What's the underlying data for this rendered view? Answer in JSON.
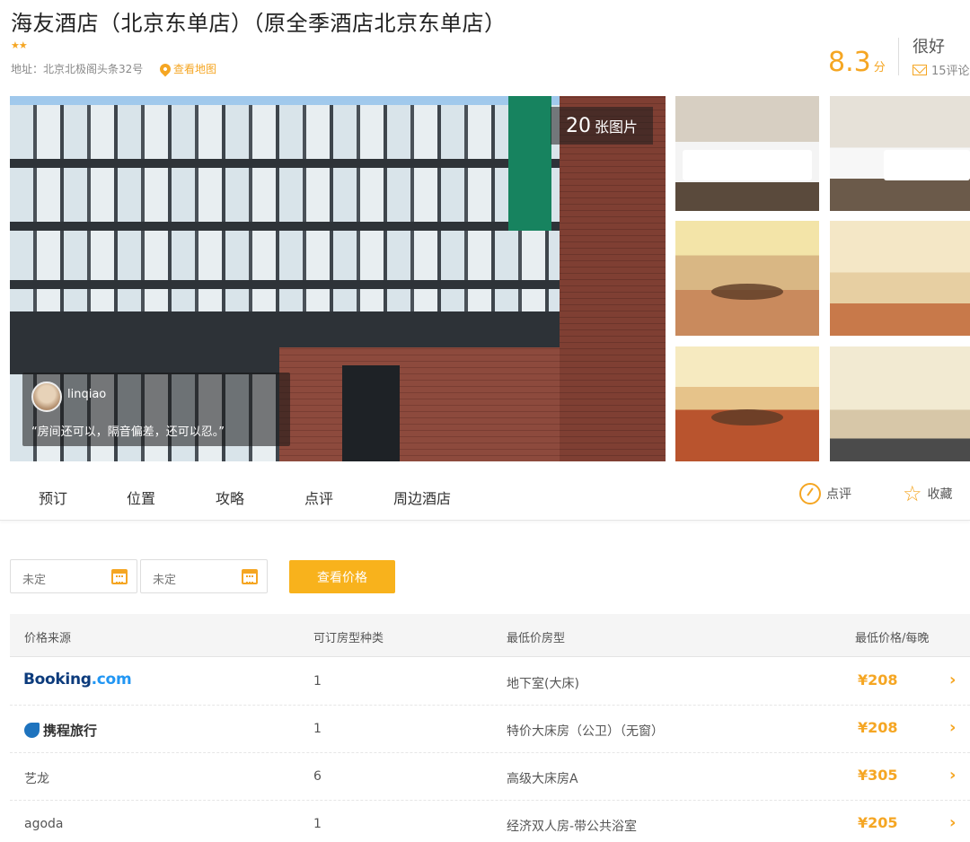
{
  "hotel": {
    "title": "海友酒店（北京东单店）（原全季酒店北京东单店）",
    "stars": "★★",
    "address": "地址：北京北极阁头条32号",
    "map_link": "查看地图"
  },
  "rating": {
    "score": "8.3",
    "score_unit": "分",
    "label": "很好",
    "reviews": "15评论"
  },
  "gallery": {
    "photo_count": "20",
    "photo_count_label": "张图片",
    "review_user": "linqiao",
    "review_quote": "“房间还可以，隔音偏差，还可以忍。”"
  },
  "tabs": [
    "预订",
    "位置",
    "攻略",
    "点评",
    "周边酒店"
  ],
  "actions": {
    "review": "点评",
    "favorite": "收藏"
  },
  "search": {
    "checkin": "未定",
    "checkout": "未定",
    "button": "查看价格"
  },
  "table": {
    "headers": [
      "价格来源",
      "可订房型种类",
      "最低价房型",
      "最低价格/每晚"
    ],
    "rows": [
      {
        "source": "Booking.com",
        "source_a": "Booking",
        "source_b": ".com",
        "count": "1",
        "room": "地下室(大床)",
        "price": "¥208"
      },
      {
        "source": "携程旅行",
        "count": "1",
        "room": "特价大床房（公卫）（无窗）",
        "price": "¥208"
      },
      {
        "source": "艺龙",
        "count": "6",
        "room": "高级大床房A",
        "price": "¥305"
      },
      {
        "source": "agoda",
        "count": "1",
        "room": "经济双人房-带公共浴室",
        "price": "¥205"
      }
    ]
  },
  "colors": {
    "accent": "#f5a623",
    "button": "#f8b21c",
    "booking_blue": "#0c3b7c"
  }
}
